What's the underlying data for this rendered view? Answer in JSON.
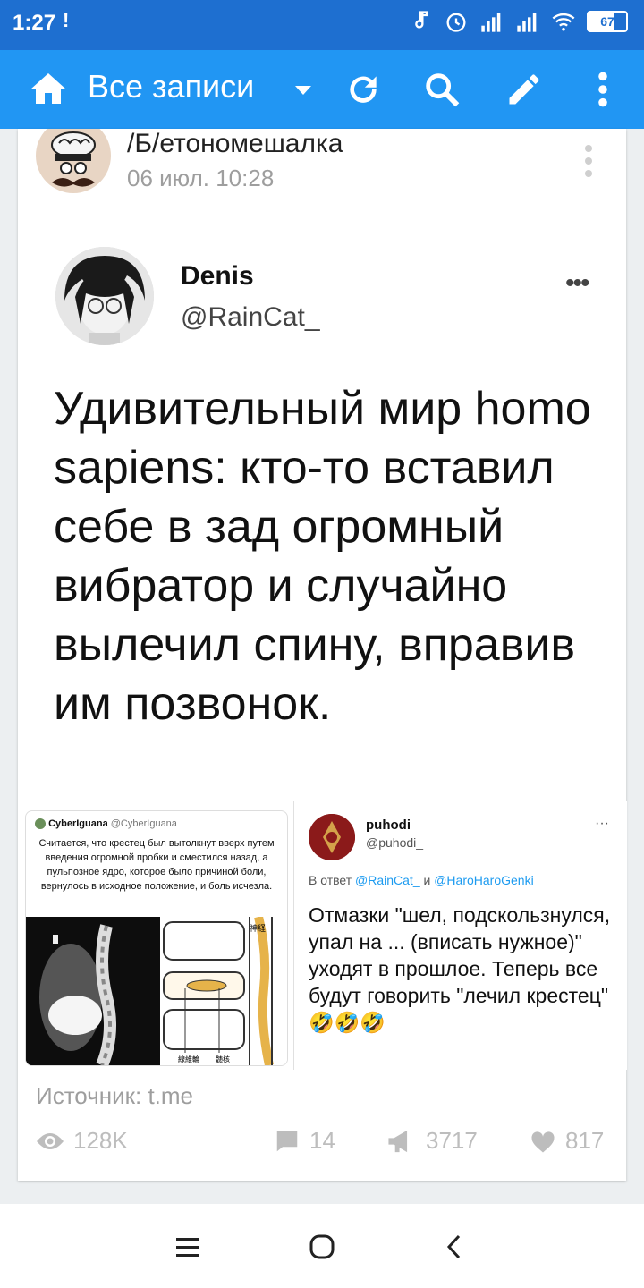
{
  "status_bar": {
    "time": "1:27",
    "notif_glyph": "!",
    "battery": "67",
    "icons": [
      "music-note-icon",
      "alarm-icon",
      "signal-icon",
      "signal-icon",
      "wifi-icon",
      "battery-icon"
    ]
  },
  "toolbar": {
    "title": "Все записи",
    "icons": [
      "home-icon",
      "chevron-down-icon",
      "refresh-icon",
      "search-icon",
      "edit-icon",
      "more-vertical-icon"
    ]
  },
  "post": {
    "title": "/Б/етономешалка",
    "date": "06 июл. 10:28",
    "tweet": {
      "name": "Denis",
      "handle": "@RainCat_",
      "more": "•••",
      "text": "Удивительный мир homo sapiens: кто-то вставил себе в зад огромный вибратор и случайно вылечил спину, вправив им позвонок."
    },
    "image_left": {
      "name": "CyberIguana",
      "handle": "@CyberIguana",
      "text": "Считается, что крестец был вытолкнут вверх путем введения огромной пробки и сместился назад, а пульпозное ядро, которое было причиной боли, вернулось в исходное положение, и боль исчезла.",
      "diagram_labels": [
        "神経",
        "線維輪",
        "髄核"
      ]
    },
    "image_right": {
      "name": "puhodi",
      "handle": "@puhodi_",
      "more": "···",
      "reply_prefix": "В ответ",
      "reply_mention_1": "@RainCat_",
      "reply_and": "и",
      "reply_mention_2": "@HaroHaroGenki",
      "text": "Отмазки \"шел, подскользнулся, упал на ... (вписать нужное)\" уходят в прошлое. Теперь все будут говорить \"лечил крестец\" 🤣🤣🤣"
    },
    "source_label": "Источник:",
    "source_link": "t.me",
    "stats": {
      "views": "128K",
      "comments": "14",
      "reposts": "3717",
      "likes": "817"
    }
  },
  "colors": {
    "status_bar": "#1e6fd0",
    "toolbar": "#2196f3",
    "background": "#eceff1",
    "muted": "#9e9e9e"
  }
}
